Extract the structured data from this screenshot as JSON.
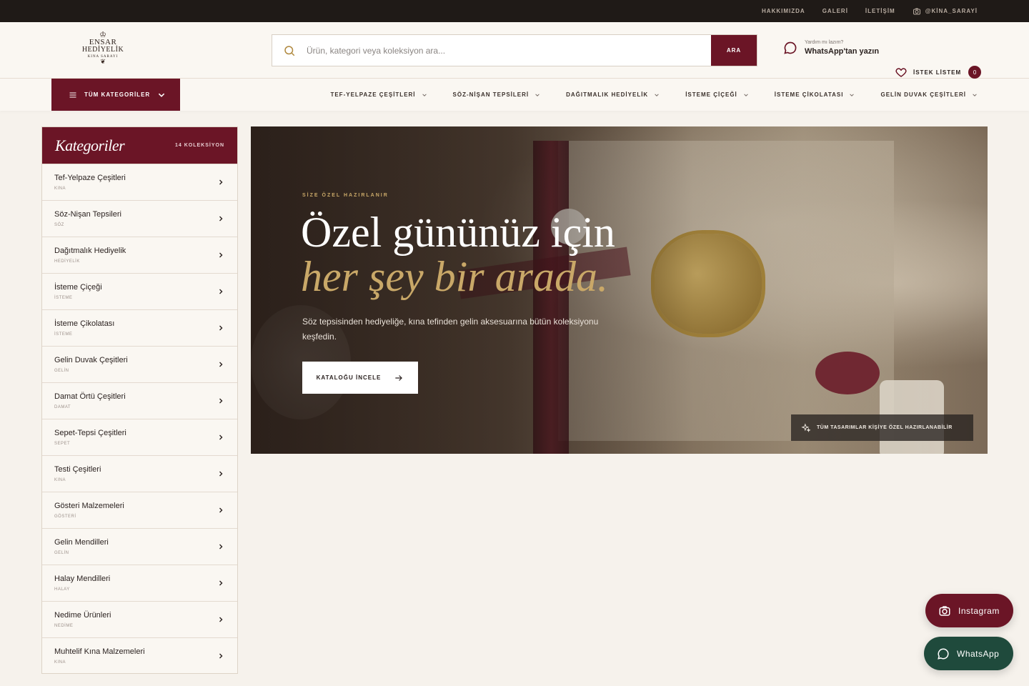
{
  "topbar": {
    "links": [
      "HAKKIMIZDA",
      "GALERİ",
      "İLETİŞİM"
    ],
    "instagram": "@KİNA_SARAYİ"
  },
  "logo": {
    "line1": "ENSAR",
    "line2": "HEDİYELİK",
    "line3": "KINA SARAYI"
  },
  "search": {
    "placeholder": "Ürün, kategori veya koleksiyon ara...",
    "button": "ARA"
  },
  "help": {
    "small": "Yardım mı lazım?",
    "big": "WhatsApp'tan yazın"
  },
  "wishlist": {
    "label": "İSTEK LİSTEM",
    "count": "0"
  },
  "nav": {
    "all_categories": "TÜM KATEGORİLER",
    "items": [
      "TEF-YELPAZE ÇEŞİTLERİ",
      "SÖZ-NİŞAN TEPSİLERİ",
      "DAĞITMALIK HEDİYELİK",
      "İSTEME ÇİÇEĞİ",
      "İSTEME ÇİKOLATASI",
      "GELİN DUVAK ÇEŞİTLERİ"
    ]
  },
  "sidebar": {
    "title": "Kategoriler",
    "count": "14 KOLEKSİYON",
    "items": [
      {
        "name": "Tef-Yelpaze Çeşitleri",
        "sub": "KINA"
      },
      {
        "name": "Söz-Nişan Tepsileri",
        "sub": "SÖZ"
      },
      {
        "name": "Dağıtmalık Hediyelik",
        "sub": "HEDİYELİK"
      },
      {
        "name": "İsteme Çiçeği",
        "sub": "İSTEME"
      },
      {
        "name": "İsteme Çikolatası",
        "sub": "İSTEME"
      },
      {
        "name": "Gelin Duvak Çeşitleri",
        "sub": "GELİN"
      },
      {
        "name": "Damat Örtü Çeşitleri",
        "sub": "DAMAT"
      },
      {
        "name": "Sepet-Tepsi Çeşitleri",
        "sub": "SEPET"
      },
      {
        "name": "Testi Çeşitleri",
        "sub": "KINA"
      },
      {
        "name": "Gösteri Malzemeleri",
        "sub": "GÖSTERİ"
      },
      {
        "name": "Gelin Mendilleri",
        "sub": "GELİN"
      },
      {
        "name": "Halay Mendilleri",
        "sub": "HALAY"
      },
      {
        "name": "Nedime Ürünleri",
        "sub": "NEDİME"
      },
      {
        "name": "Muhtelif Kına Malzemeleri",
        "sub": "KINA"
      }
    ]
  },
  "hero": {
    "eyebrow": "SİZE ÖZEL HAZIRLANIR",
    "line1": "Özel gününüz için",
    "line2": "her şey bir arada.",
    "description": "Söz tepsisinden hediyeliğe, kına tefinden gelin aksesuarına bütün koleksiyonu keşfedin.",
    "cta": "KATALOĞU İNCELE",
    "tag": "TÜM TASARIMLAR KİŞİYE ÖZEL HAZIRLANABİLİR"
  },
  "floating": {
    "instagram": "Instagram",
    "whatsapp": "WhatsApp"
  },
  "colors": {
    "brand": "#6b1526",
    "gold": "#c9a868",
    "whatsapp": "#1f4a3c",
    "topbar": "#1f1a17"
  }
}
